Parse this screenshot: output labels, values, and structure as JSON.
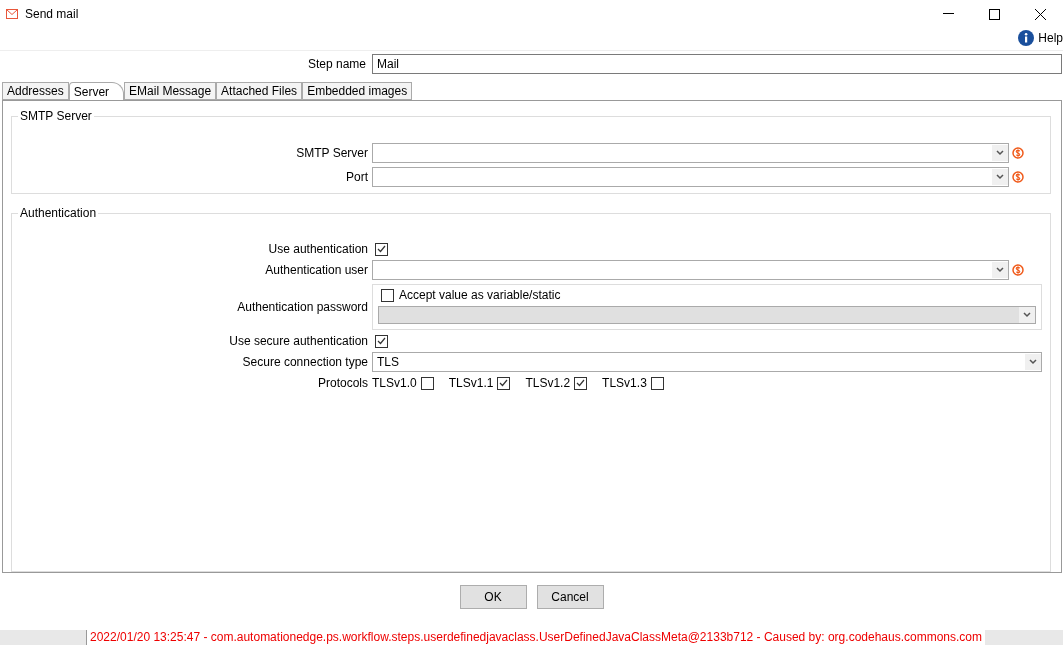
{
  "window": {
    "title": "Send mail"
  },
  "help": "Help",
  "step_name": {
    "label": "Step name",
    "value": "Mail"
  },
  "tabs": [
    {
      "label": "Addresses",
      "selected": false
    },
    {
      "label": "Server",
      "selected": true
    },
    {
      "label": "EMail Message",
      "selected": false
    },
    {
      "label": "Attached Files",
      "selected": false
    },
    {
      "label": "Embedded images",
      "selected": false
    }
  ],
  "smtp_group": {
    "title": "SMTP Server",
    "fields": [
      {
        "label": "SMTP Server"
      },
      {
        "label": "Port"
      }
    ]
  },
  "auth_group": {
    "title": "Authentication",
    "use_authentication": {
      "label": "Use authentication",
      "checked": true
    },
    "authentication_user": {
      "label": "Authentication user"
    },
    "authentication_password": {
      "label": "Authentication password",
      "accept_variable": {
        "label": "Accept value as variable/static",
        "checked": false
      },
      "disabled": true
    },
    "use_secure_authentication": {
      "label": "Use secure authentication",
      "checked": true
    },
    "secure_connection_type": {
      "label": "Secure connection type",
      "value": "TLS"
    },
    "protocols": {
      "label": "Protocols",
      "items": [
        {
          "label": "TLSv1.0",
          "checked": false
        },
        {
          "label": "TLSv1.1",
          "checked": true
        },
        {
          "label": "TLSv1.2",
          "checked": true
        },
        {
          "label": "TLSv1.3",
          "checked": false
        }
      ]
    }
  },
  "buttons": [
    "OK",
    "Cancel"
  ],
  "background_log": "2022/01/20 13:25:47 - com.automationedge.ps.workflow.steps.userdefinedjavaclass.UserDefinedJavaClassMeta@2133b712 - Caused by: org.codehaus.commons.com"
}
